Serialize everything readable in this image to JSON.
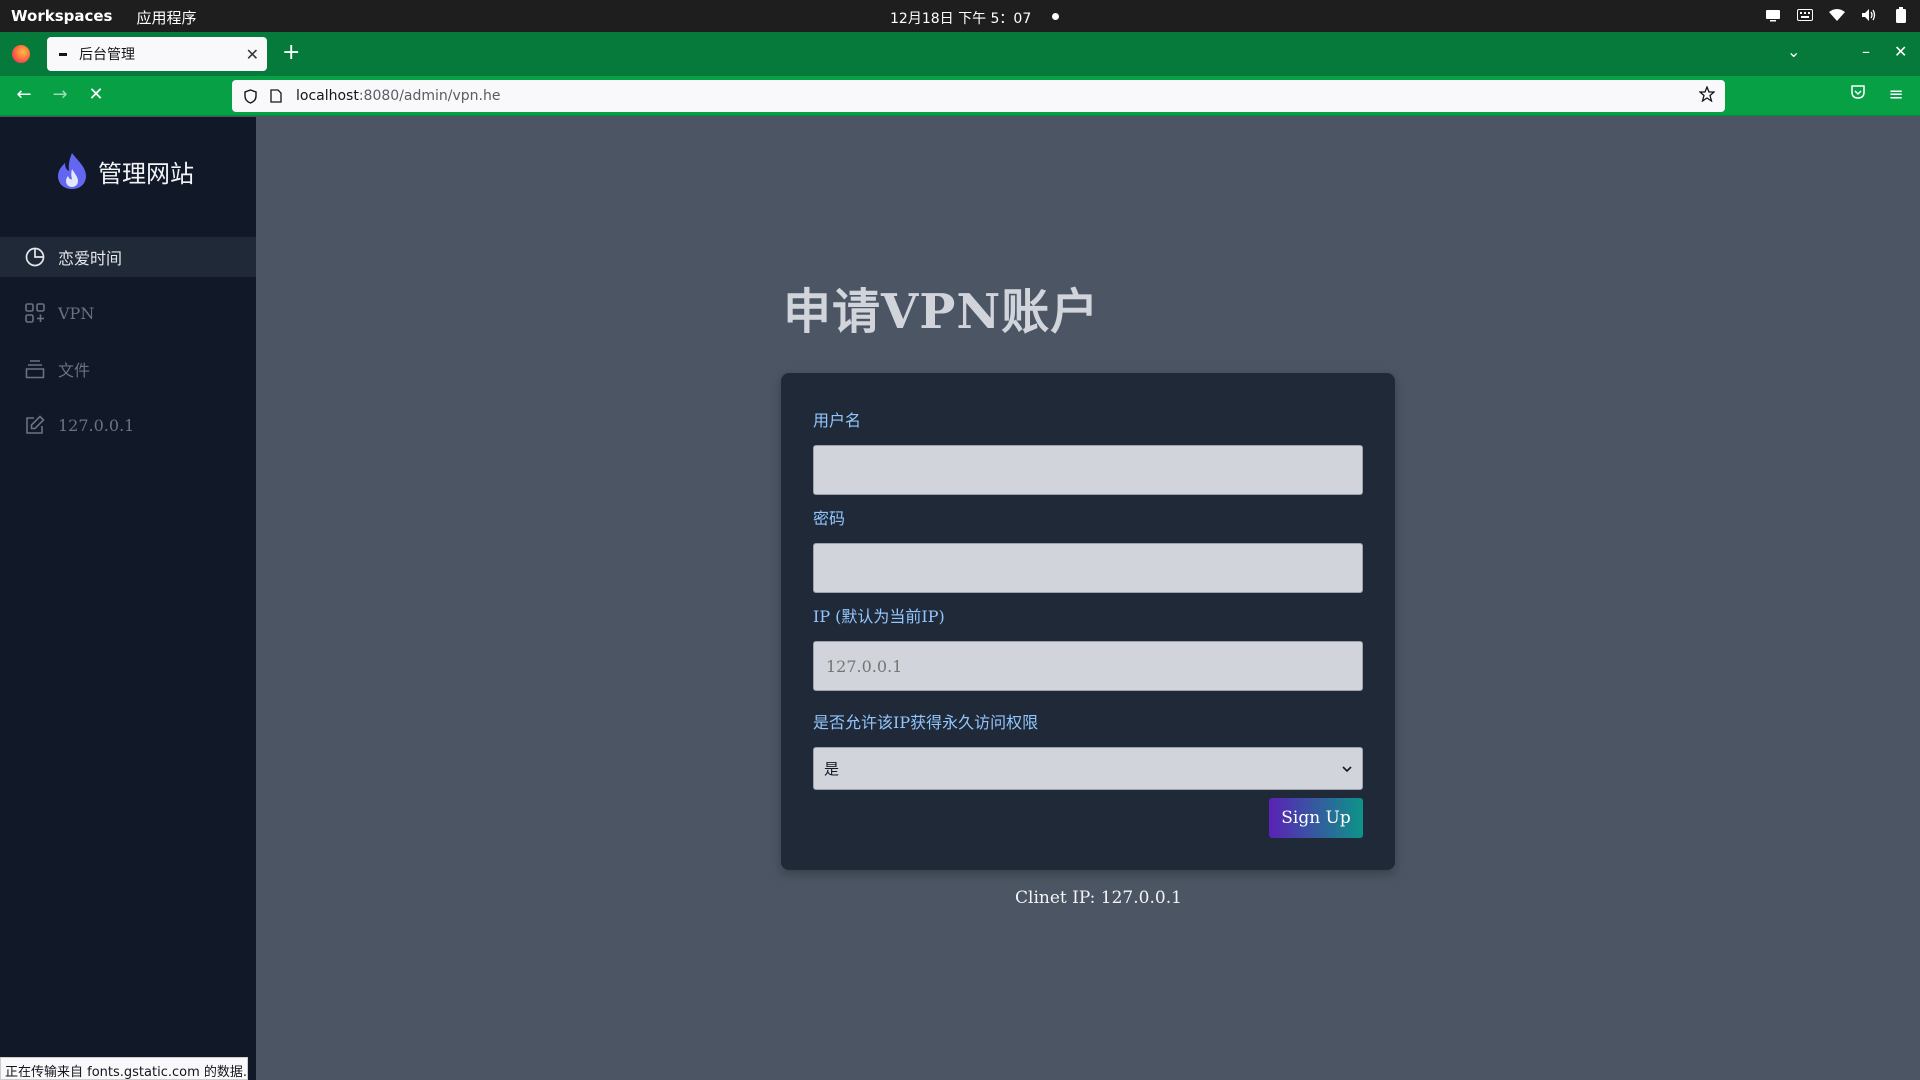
{
  "system": {
    "workspaces": "Workspaces",
    "apps": "应用程序",
    "clock": "12月18日 下午 5：07"
  },
  "browser": {
    "tab_title": "后台管理",
    "url_host": "localhost",
    "url_path": ":8080/admin/vpn.he",
    "status_text": "正在传输来自 fonts.gstatic.com 的数据..."
  },
  "sidebar": {
    "brand": "管理网站",
    "items": [
      {
        "label": "恋爱时间",
        "icon": "pie-chart-icon",
        "active": true
      },
      {
        "label": "VPN",
        "icon": "grid-plus-icon",
        "active": false
      },
      {
        "label": "文件",
        "icon": "archive-icon",
        "active": false
      },
      {
        "label": "127.0.0.1",
        "icon": "edit-icon",
        "active": false
      }
    ]
  },
  "form": {
    "title": "申请VPN账户",
    "username_label": "用户名",
    "username_value": "",
    "password_label": "密码",
    "password_value": "",
    "ip_label": "IP (默认为当前IP)",
    "ip_placeholder": "127.0.0.1",
    "permanent_label": "是否允许该IP获得永久访问权限",
    "permanent_value": "是",
    "submit_label": "Sign Up"
  },
  "footer": {
    "client_ip": "Clinet IP: 127.0.0.1"
  },
  "colors": {
    "sidebar_bg": "#111827",
    "main_bg": "#4b5563",
    "card_bg": "#1f2937",
    "label_color": "#93c5fd",
    "browser_green": "#07a044"
  }
}
